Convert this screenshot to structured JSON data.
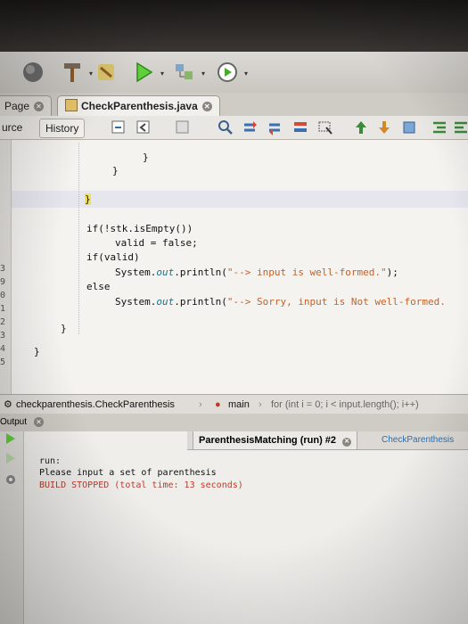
{
  "tabs": {
    "start_page": "Page",
    "file": "CheckParenthesis.java"
  },
  "editor_toolbar": {
    "source": "urce",
    "history": "History"
  },
  "code_lines": [
    "}",
    "}",
    "}",
    "if(!stk.isEmpty())",
    "valid = false;",
    "if(valid)",
    "System.",
    "out",
    ".println(",
    "\"--> input is well-formed.\"",
    ");",
    "else",
    "System.",
    "out",
    ".println(",
    "\"--> Sorry, input is Not well-formed.",
    "}",
    "}"
  ],
  "line_numbers": [
    "3",
    "9",
    "0",
    "1",
    "2",
    "3",
    "4",
    "5"
  ],
  "breadcrumbs": {
    "class": "checkparenthesis.CheckParenthesis",
    "method": "main",
    "loop": "for (int i = 0; i < input.length(); i++)"
  },
  "output": {
    "header": "Output",
    "run_tab": "ParenthesisMatching (run) #2",
    "run_tab2": "CheckParenthesis",
    "lines": [
      "run:",
      "Please input a set of parenthesis",
      "BUILD STOPPED (total time: 13 seconds)"
    ]
  },
  "colors": {
    "string": "#c2622a",
    "field": "#1b6f86",
    "build_stopped": "#c0392b",
    "brace_highlight": "#f6e24a"
  },
  "icons": [
    "clean-build-icon",
    "hammer-icon",
    "run-icon",
    "debug-icon",
    "profile-icon"
  ]
}
